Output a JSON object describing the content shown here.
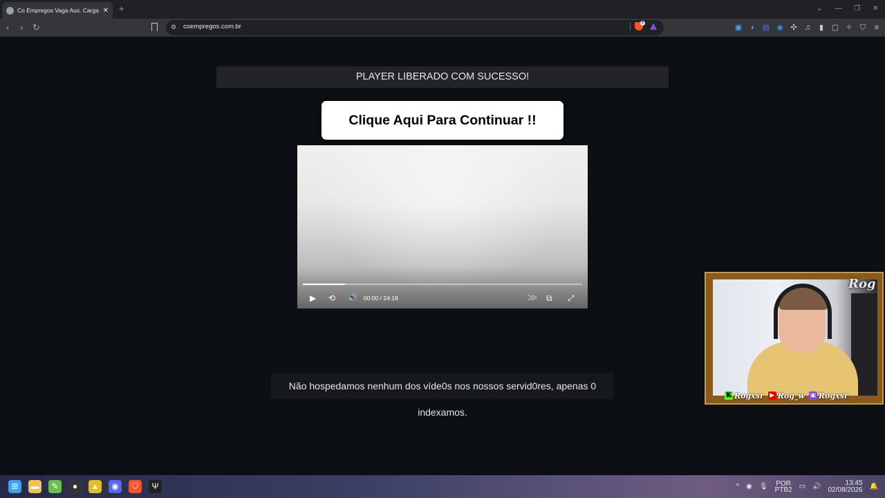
{
  "browser": {
    "tab_title": "Co Empregos Vaga Aux. Carga e",
    "new_tab": "+",
    "close": "✕",
    "window_controls": [
      "⌄",
      "—",
      "❐",
      "✕"
    ],
    "url": "coempregos.com.br",
    "shield_badge": "8",
    "back_icon": "‹",
    "forward_icon": "›",
    "reload_icon": "↻",
    "extension_icons": [
      "▣",
      "◖",
      "▤",
      "◉",
      "✣",
      "♫",
      "▮",
      "▢",
      "✧",
      "⛉",
      "≡"
    ]
  },
  "page": {
    "banner": "PLAYER LIBERADO COM SUCESSO!",
    "cta": "Clique Aqui Para Continuar !!",
    "disclaimer": "Não hospedamos nenhum dos víde0s nos nossos servid0res, apenas 0 indexamos."
  },
  "player": {
    "current_time": "00:00",
    "separator": "/",
    "duration": "24:18",
    "progress": 0.15,
    "play_icon": "▶",
    "replay_icon": "⟲",
    "volume_icon": "🔊",
    "skip_icon": "≫",
    "pip_icon": "⧉",
    "fullscreen_icon": "⤢"
  },
  "webcam": {
    "logo": "Rog",
    "socials": [
      {
        "platform": "kick",
        "handle": "Rogxsr",
        "icon": "K",
        "color": "#53fc18"
      },
      {
        "platform": "youtube",
        "handle": "Rog_w",
        "icon": "▶",
        "color": "#ff0000"
      },
      {
        "platform": "twitch",
        "handle": "Rogxsr",
        "icon": "▣",
        "color": "#9146ff"
      }
    ]
  },
  "taskbar": {
    "apps": [
      {
        "name": "windows-start",
        "glyph": "⊞",
        "color": "#3aa0f0"
      },
      {
        "name": "file-explorer",
        "glyph": "▬",
        "color": "#f2c14e"
      },
      {
        "name": "notepad-app",
        "glyph": "✎",
        "color": "#6cbf4f"
      },
      {
        "name": "obs-app",
        "glyph": "●",
        "color": "#333333"
      },
      {
        "name": "triangle-app",
        "glyph": "▲",
        "color": "#e0c020"
      },
      {
        "name": "discord-app",
        "glyph": "◉",
        "color": "#5865f2"
      },
      {
        "name": "brave-app",
        "glyph": "⛉",
        "color": "#fb542b"
      },
      {
        "name": "trident-app",
        "glyph": "Ψ",
        "color": "#222222"
      }
    ],
    "tray_chevron": "^",
    "tray_icons": [
      "◉",
      "🎙"
    ],
    "lang_top": "POR",
    "lang_bottom": "PTB2",
    "sys_icons": [
      "▭",
      "🔊"
    ],
    "time": "13:45",
    "date": "02/08/2026",
    "notification_icon": "🔔"
  }
}
